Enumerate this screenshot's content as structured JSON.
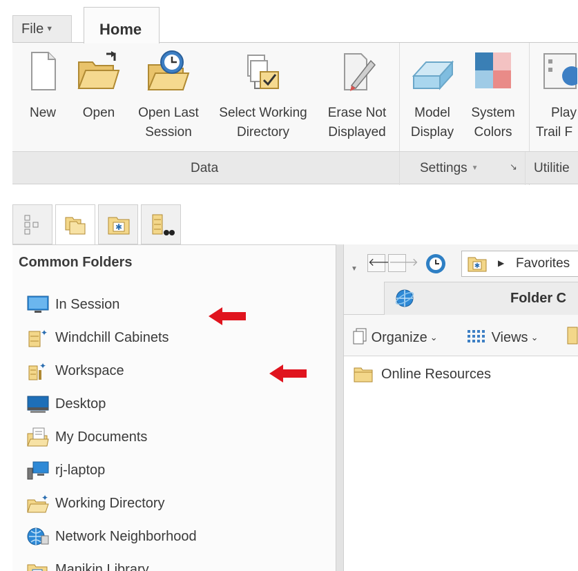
{
  "menu": {
    "file_label": "File",
    "home_label": "Home"
  },
  "ribbon": {
    "buttons": [
      {
        "label_line1": "New",
        "label_line2": "",
        "icon": "new-document-icon"
      },
      {
        "label_line1": "Open",
        "label_line2": "",
        "icon": "open-folder-icon"
      },
      {
        "label_line1": "Open Last",
        "label_line2": "Session",
        "icon": "open-last-session-icon"
      },
      {
        "label_line1": "Select Working",
        "label_line2": "Directory",
        "icon": "select-working-directory-icon"
      },
      {
        "label_line1": "Erase Not",
        "label_line2": "Displayed",
        "icon": "erase-not-displayed-icon"
      },
      {
        "label_line1": "Model",
        "label_line2": "Display",
        "icon": "model-display-icon"
      },
      {
        "label_line1": "System",
        "label_line2": "Colors",
        "icon": "system-colors-icon"
      },
      {
        "label_line1": "Play",
        "label_line2": "Trail F",
        "icon": "play-trail-file-icon"
      }
    ],
    "groups": {
      "data": "Data",
      "settings": "Settings",
      "utilities": "Utilitie"
    }
  },
  "navigator": {
    "tabs": [
      "model-tree-icon",
      "folder-browser-icon",
      "favorites-icon",
      "windchill-connections-icon"
    ],
    "panel_title": "Common Folders",
    "folders": [
      {
        "label": "In Session",
        "icon": "in-session-icon"
      },
      {
        "label": "Windchill Cabinets",
        "icon": "windchill-cabinets-icon"
      },
      {
        "label": "Workspace",
        "icon": "workspace-icon"
      },
      {
        "label": "Desktop",
        "icon": "desktop-icon"
      },
      {
        "label": "My Documents",
        "icon": "my-documents-icon"
      },
      {
        "label": "rj-laptop",
        "icon": "computer-icon"
      },
      {
        "label": "Working Directory",
        "icon": "working-directory-icon"
      },
      {
        "label": "Network Neighborhood",
        "icon": "network-neighborhood-icon"
      },
      {
        "label": "Manikin Library",
        "icon": "manikin-library-icon"
      }
    ]
  },
  "browser": {
    "address": "Favorites",
    "tab_label": "Folder C",
    "toolbar": {
      "organize": "Organize",
      "views": "Views"
    },
    "files": [
      {
        "label": "Online Resources",
        "icon": "folder-icon"
      }
    ]
  },
  "colors": {
    "annotation_arrow": "#e0141e",
    "folder_yellow": "#f3d78a",
    "accent_blue": "#3d7fc4"
  }
}
